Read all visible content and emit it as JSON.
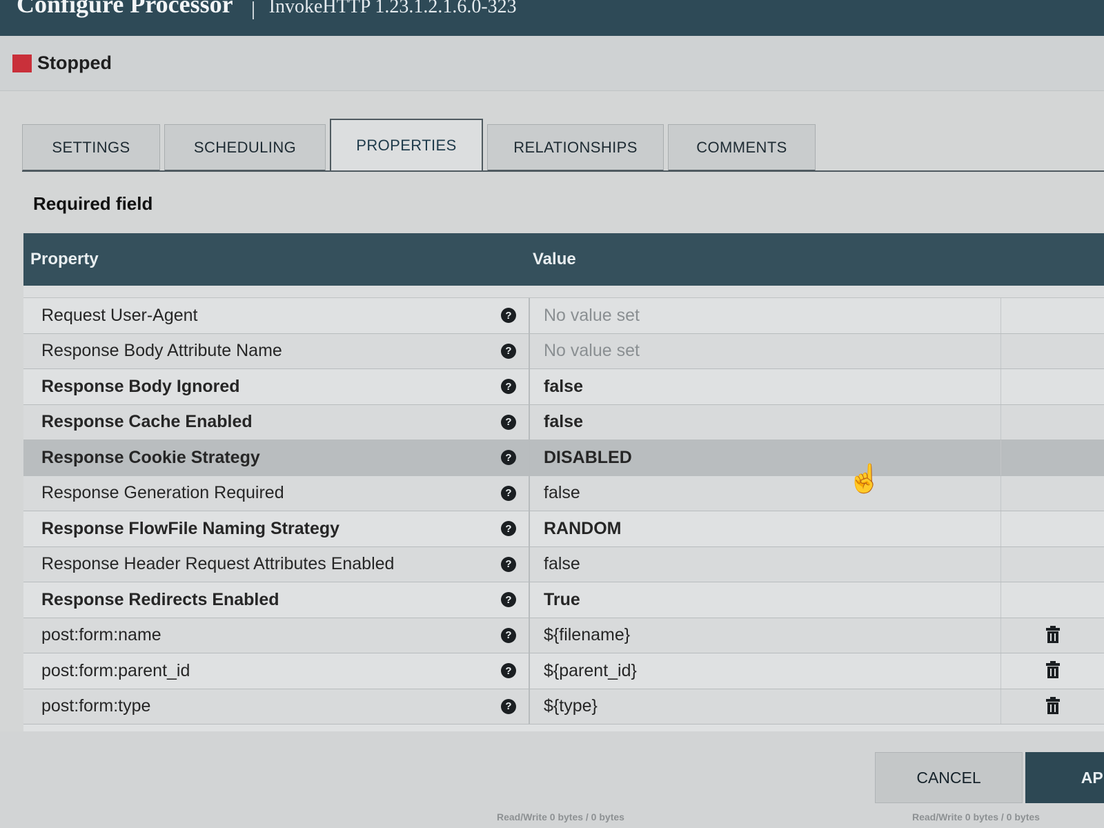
{
  "dialog": {
    "title": "Configure Processor",
    "processor_type": "InvokeHTTP 1.23.1.2.1.6.0-323",
    "status": "Stopped",
    "status_color": "#c9303a"
  },
  "tabs": [
    {
      "label": "SETTINGS",
      "active": false
    },
    {
      "label": "SCHEDULING",
      "active": false
    },
    {
      "label": "PROPERTIES",
      "active": true
    },
    {
      "label": "RELATIONSHIPS",
      "active": false
    },
    {
      "label": "COMMENTS",
      "active": false
    }
  ],
  "required_label": "Required field",
  "table": {
    "columns": {
      "property": "Property",
      "value": "Value"
    },
    "rows": [
      {
        "name": "Request User-Agent",
        "value": "No value set",
        "required": false,
        "unset": true,
        "deletable": false
      },
      {
        "name": "Response Body Attribute Name",
        "value": "No value set",
        "required": false,
        "unset": true,
        "deletable": false
      },
      {
        "name": "Response Body Ignored",
        "value": "false",
        "required": true,
        "unset": false,
        "deletable": false
      },
      {
        "name": "Response Cache Enabled",
        "value": "false",
        "required": true,
        "unset": false,
        "deletable": false
      },
      {
        "name": "Response Cookie Strategy",
        "value": "DISABLED",
        "required": true,
        "unset": false,
        "deletable": false,
        "hover": true
      },
      {
        "name": "Response Generation Required",
        "value": "false",
        "required": false,
        "unset": false,
        "deletable": false
      },
      {
        "name": "Response FlowFile Naming Strategy",
        "value": "RANDOM",
        "required": true,
        "unset": false,
        "deletable": false
      },
      {
        "name": "Response Header Request Attributes Enabled",
        "value": "false",
        "required": false,
        "unset": false,
        "deletable": false
      },
      {
        "name": "Response Redirects Enabled",
        "value": "True",
        "required": true,
        "unset": false,
        "deletable": false
      },
      {
        "name": "post:form:name",
        "value": "${filename}",
        "required": false,
        "unset": false,
        "deletable": true
      },
      {
        "name": "post:form:parent_id",
        "value": "${parent_id}",
        "required": false,
        "unset": false,
        "deletable": true
      },
      {
        "name": "post:form:type",
        "value": "${type}",
        "required": false,
        "unset": false,
        "deletable": true
      }
    ]
  },
  "buttons": {
    "cancel": "CANCEL",
    "apply": "APP"
  },
  "footer_stats": [
    {
      "label": "Read/Write",
      "value": "0 bytes / 0 bytes"
    },
    {
      "label": "Read/Write",
      "value": "0 bytes / 0 bytes"
    }
  ]
}
